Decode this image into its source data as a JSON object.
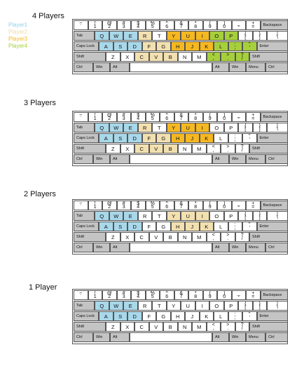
{
  "colors": {
    "player1": "#a8d8ea",
    "player2": "#f2e0b0",
    "player3": "#f5b821",
    "player4": "#a6cf3c",
    "gray_key": "#c4c4c4"
  },
  "legend": [
    {
      "label": "Player1",
      "color": "player1"
    },
    {
      "label": "Player2",
      "color": "player2"
    },
    {
      "label": "Player3",
      "color": "player3"
    },
    {
      "label": "Player4",
      "color": "player4"
    }
  ],
  "keyboard_rows": [
    [
      {
        "t": "~",
        "b": "`"
      },
      {
        "t": "!",
        "b": "1"
      },
      {
        "t": "@",
        "b": "2"
      },
      {
        "t": "#",
        "b": "3"
      },
      {
        "t": "$",
        "b": "4"
      },
      {
        "t": "%",
        "b": "5"
      },
      {
        "t": "^",
        "b": "6"
      },
      {
        "t": "&",
        "b": "7"
      },
      {
        "t": "*",
        "b": "8"
      },
      {
        "t": "(",
        "b": "9"
      },
      {
        "t": ")",
        "b": "0"
      },
      {
        "t": "_",
        "b": "-"
      },
      {
        "t": "+",
        "b": "="
      },
      {
        "label": "Backspace",
        "gray": true
      }
    ],
    [
      {
        "label": "Tab",
        "gray": true
      },
      {
        "c": "Q"
      },
      {
        "c": "W"
      },
      {
        "c": "E"
      },
      {
        "c": "R"
      },
      {
        "c": "T"
      },
      {
        "c": "Y"
      },
      {
        "c": "U"
      },
      {
        "c": "I"
      },
      {
        "c": "O"
      },
      {
        "c": "P"
      },
      {
        "t": "{",
        "b": "["
      },
      {
        "t": "}",
        "b": "]"
      },
      {
        "t": "|",
        "b": "\\"
      }
    ],
    [
      {
        "label": "Caps Lock",
        "gray": true
      },
      {
        "c": "A"
      },
      {
        "c": "S"
      },
      {
        "c": "D"
      },
      {
        "c": "F"
      },
      {
        "c": "G"
      },
      {
        "c": "H"
      },
      {
        "c": "J"
      },
      {
        "c": "K"
      },
      {
        "c": "L"
      },
      {
        "t": ":",
        "b": ";"
      },
      {
        "t": "\"",
        "b": "'"
      },
      {
        "label": "Enter",
        "gray": true
      }
    ],
    [
      {
        "label": "Shift",
        "gray": true
      },
      {
        "c": "Z"
      },
      {
        "c": "X"
      },
      {
        "c": "C"
      },
      {
        "c": "V"
      },
      {
        "c": "B"
      },
      {
        "c": "N"
      },
      {
        "c": "M"
      },
      {
        "t": "<",
        "b": ","
      },
      {
        "t": ">",
        "b": "."
      },
      {
        "t": "?",
        "b": "/"
      },
      {
        "label": "Shift",
        "gray": true
      }
    ],
    [
      {
        "label": "Ctrl",
        "gray": true
      },
      {
        "label": "Win",
        "gray": true
      },
      {
        "label": "Alt",
        "gray": true
      },
      {
        "c": ""
      },
      {
        "label": "Alt",
        "gray": true
      },
      {
        "label": "Win",
        "gray": true
      },
      {
        "label": "Menu",
        "gray": true
      },
      {
        "label": "Ctrl",
        "gray": true
      }
    ]
  ],
  "sections": [
    {
      "title": "4 Players",
      "players": {
        "player1": [
          "Q",
          "W",
          "E",
          "A",
          "S",
          "D"
        ],
        "player2": [
          "R",
          "F",
          "G",
          "C",
          "V",
          "B"
        ],
        "player3": [
          "Y",
          "U",
          "I",
          "H",
          "J",
          "K"
        ],
        "player4": [
          "O",
          "P",
          "L",
          ";",
          "'",
          ",",
          ".",
          "/"
        ]
      }
    },
    {
      "title": "3 Players",
      "players": {
        "player1": [
          "Q",
          "W",
          "E",
          "A",
          "S",
          "D"
        ],
        "player2": [
          "R",
          "F",
          "G",
          "C",
          "V",
          "B"
        ],
        "player3": [
          "Y",
          "U",
          "I",
          "H",
          "J",
          "K"
        ]
      }
    },
    {
      "title": "2 Players",
      "players": {
        "player1": [
          "Q",
          "W",
          "E",
          "A",
          "S",
          "D"
        ],
        "player2": [
          "Y",
          "U",
          "I",
          "H",
          "J",
          "K"
        ]
      }
    },
    {
      "title": "1 Player",
      "players": {
        "player1": [
          "Q",
          "W",
          "E",
          "A",
          "S",
          "D"
        ]
      }
    }
  ]
}
